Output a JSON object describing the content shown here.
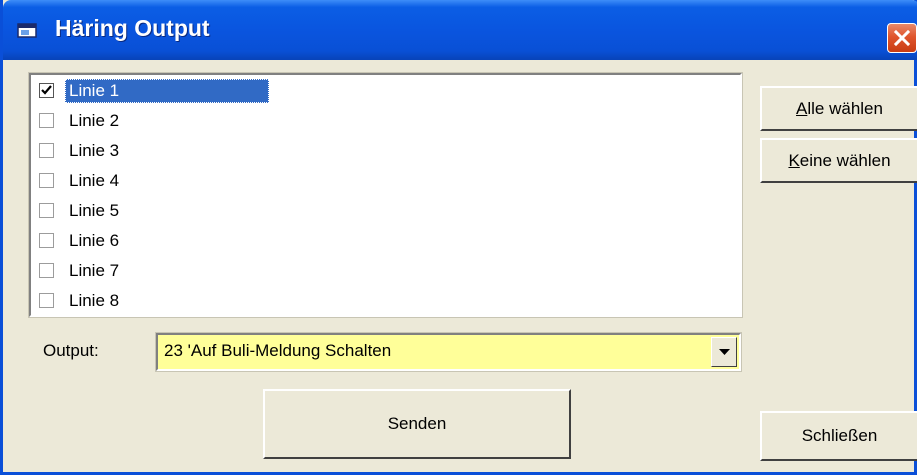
{
  "window": {
    "title": "Häring Output",
    "title_icon": "app-window-icon",
    "close_icon": "close-icon"
  },
  "list": {
    "items": [
      {
        "label": "Linie 1",
        "checked": true,
        "selected": true
      },
      {
        "label": "Linie 2",
        "checked": false,
        "selected": false
      },
      {
        "label": "Linie 3",
        "checked": false,
        "selected": false
      },
      {
        "label": "Linie 4",
        "checked": false,
        "selected": false
      },
      {
        "label": "Linie 5",
        "checked": false,
        "selected": false
      },
      {
        "label": "Linie 6",
        "checked": false,
        "selected": false
      },
      {
        "label": "Linie 7",
        "checked": false,
        "selected": false
      },
      {
        "label": "Linie 8",
        "checked": false,
        "selected": false
      }
    ]
  },
  "output": {
    "label": "Output:",
    "value": "23 'Auf Buli-Meldung Schalten",
    "background_color": "#ffff99"
  },
  "buttons": {
    "select_all": {
      "mnemonic": "A",
      "rest": "lle wählen"
    },
    "select_none": {
      "mnemonic": "K",
      "rest": "eine wählen"
    },
    "send": "Senden",
    "close": "Schließen"
  },
  "colors": {
    "titlebar": "#0a55df",
    "selection": "#316ac5",
    "face": "#ece9d8"
  }
}
